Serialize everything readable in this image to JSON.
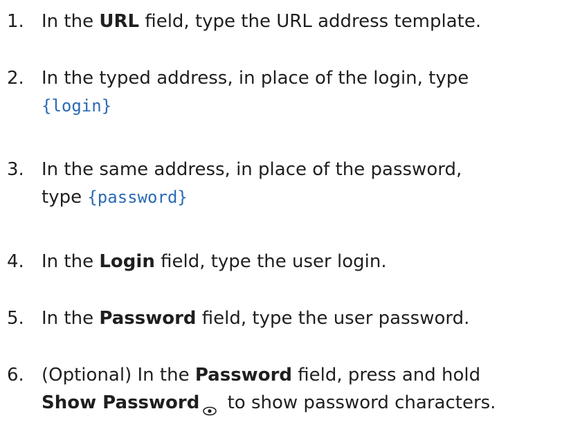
{
  "steps": [
    {
      "number": "1.",
      "line1_pre": "In the ",
      "line1_bold": "URL",
      "line1_post": " field, type the URL address template."
    },
    {
      "number": "2.",
      "line1": "In the typed address, in place of the login, type",
      "line2_code": "{login}"
    },
    {
      "number": "3.",
      "line1": "In the same address, in place of the password,",
      "line2_pre": "type ",
      "line2_code": "{password}"
    },
    {
      "number": "4.",
      "line1_pre": "In the ",
      "line1_bold": "Login",
      "line1_post": " field, type the user login."
    },
    {
      "number": "5.",
      "line1_pre": "In the ",
      "line1_bold": "Password",
      "line1_post": " field, type the user password."
    },
    {
      "number": "6.",
      "line1_pre": "(Optional) In the ",
      "line1_bold": "Password",
      "line1_post": " field, press and hold",
      "line2_bold": "Show Password",
      "line2_icon": "eye-icon",
      "line2_post": " to show password characters."
    }
  ],
  "colors": {
    "text": "#1f1f1f",
    "code": "#2a6ab5",
    "background": "#ffffff"
  }
}
